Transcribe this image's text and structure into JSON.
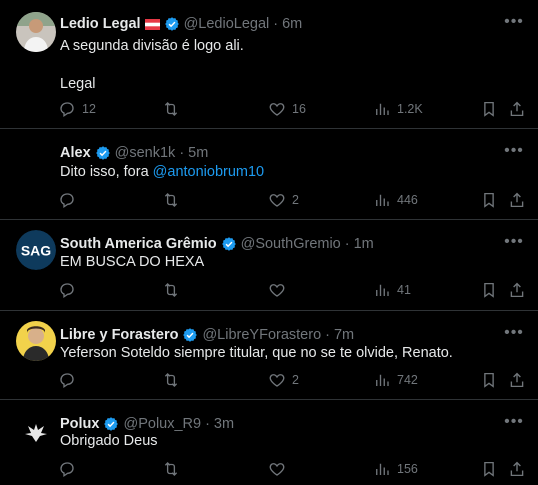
{
  "tweets": [
    {
      "name": "Ledio Legal",
      "handle": "@LedioLegal",
      "time": "6m",
      "text": "A segunda divisão é logo ali.\n\nLegal",
      "reply_count": "12",
      "retweet_count": "",
      "like_count": "16",
      "view_count": "1.2K",
      "avatar": "person-photo",
      "has_flag": true
    },
    {
      "name": "Alex",
      "handle": "@senk1k",
      "time": "5m",
      "text_prefix": "Dito isso, fora ",
      "mention": "@antoniobrum10",
      "reply_count": "",
      "retweet_count": "",
      "like_count": "2",
      "view_count": "446",
      "avatar": "none"
    },
    {
      "name": "South America Grêmio",
      "handle": "@SouthGremio",
      "time": "1m",
      "text": "EM BUSCA DO HEXA",
      "reply_count": "",
      "retweet_count": "",
      "like_count": "",
      "view_count": "41",
      "avatar": "sag-logo"
    },
    {
      "name": "Libre y Forastero",
      "handle": "@LibreYForastero",
      "time": "7m",
      "text": "Yeferson Soteldo siempre titular, que no se te olvide, Renato.",
      "reply_count": "",
      "retweet_count": "",
      "like_count": "2",
      "view_count": "742",
      "avatar": "cartoon-person"
    },
    {
      "name": "Polux",
      "handle": "@Polux_R9",
      "time": "3m",
      "text": "Obrigado Deus",
      "reply_count": "",
      "retweet_count": "",
      "like_count": "",
      "view_count": "156",
      "avatar": "winged-logo"
    }
  ],
  "dot": "·",
  "sag_text": "SAG",
  "colors": {
    "background": "#000000",
    "text": "#e7e9ea",
    "muted": "#71767b",
    "link": "#1d9bf0",
    "verified": "#1d9bf0",
    "divider": "#2f3336"
  }
}
